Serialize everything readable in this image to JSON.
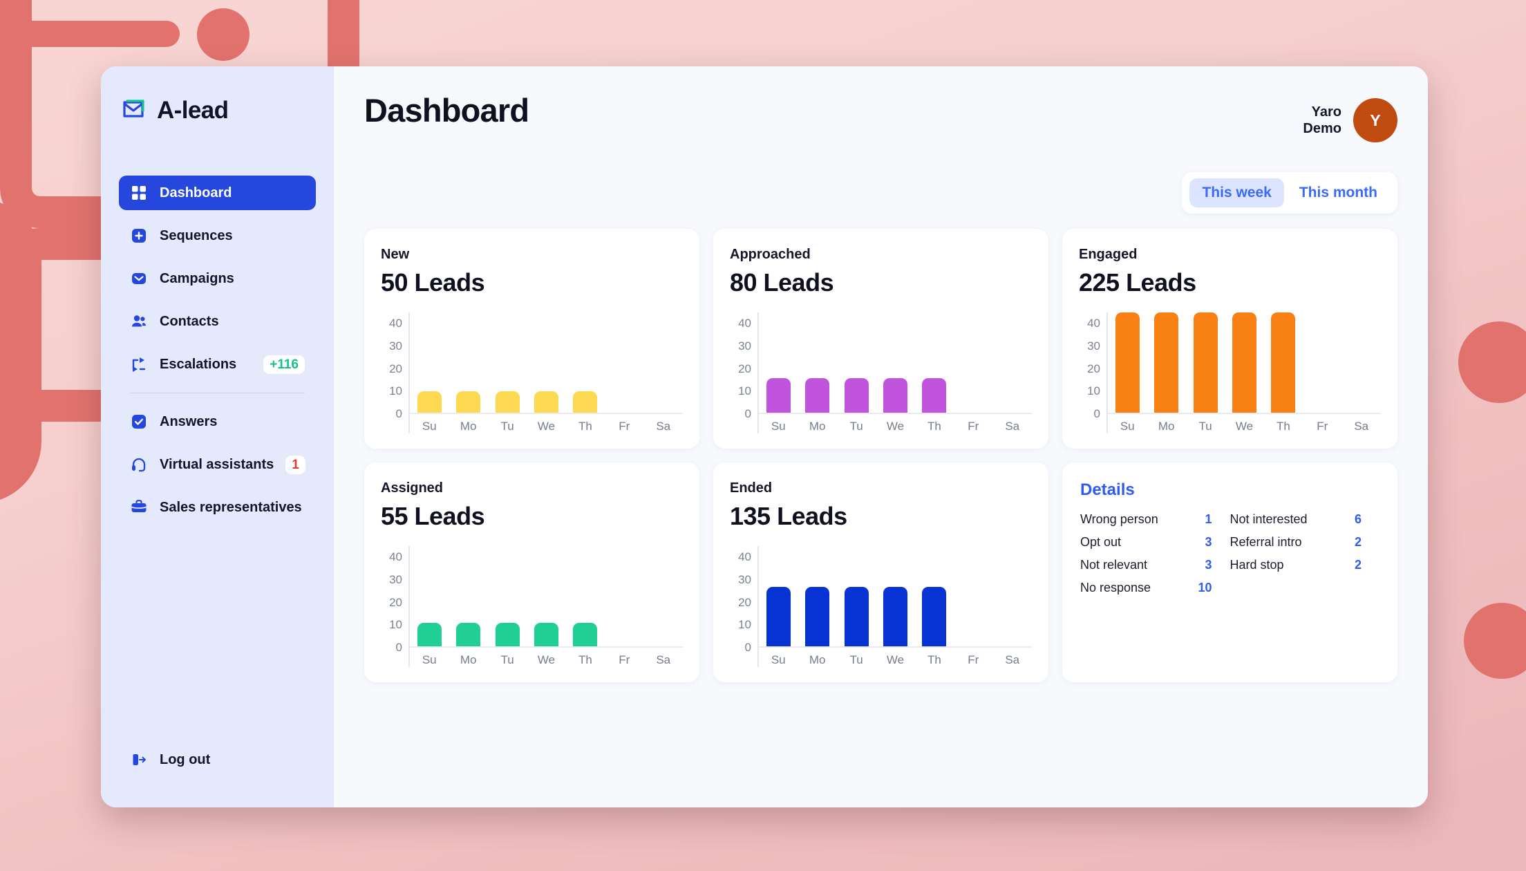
{
  "brand": {
    "name": "A-lead",
    "logo_icon": "envelope-logo-icon"
  },
  "sidebar": {
    "items": [
      {
        "label": "Dashboard",
        "icon": "grid-icon",
        "active": true,
        "badge": null
      },
      {
        "label": "Sequences",
        "icon": "plus-square-icon",
        "active": false,
        "badge": null
      },
      {
        "label": "Campaigns",
        "icon": "envelope-icon",
        "active": false,
        "badge": null
      },
      {
        "label": "Contacts",
        "icon": "people-icon",
        "active": false,
        "badge": null
      },
      {
        "label": "Escalations",
        "icon": "escalation-icon",
        "active": false,
        "badge": "+116",
        "badge_color": "green"
      },
      {
        "label": "Answers",
        "icon": "check-square-icon",
        "active": false,
        "badge": null
      },
      {
        "label": "Virtual assistants",
        "icon": "headset-icon",
        "active": false,
        "badge": "1",
        "badge_color": "red"
      },
      {
        "label": "Sales representatives",
        "icon": "briefcase-icon",
        "active": false,
        "badge": null
      }
    ],
    "logout": {
      "label": "Log out",
      "icon": "logout-icon"
    }
  },
  "header": {
    "title": "Dashboard",
    "user": {
      "line1": "Yaro",
      "line2": "Demo",
      "initial": "Y"
    }
  },
  "range_toggle": {
    "options": [
      {
        "label": "This week",
        "selected": true
      },
      {
        "label": "This month",
        "selected": false
      }
    ]
  },
  "colors": {
    "accent_blue": "#2647dd",
    "new": "#fcd950",
    "approached": "#c154dc",
    "engaged": "#f98012",
    "assigned": "#1fcf93",
    "ended": "#0833d4",
    "details_value": "#2f5cf0",
    "badge_green": "#16c088",
    "badge_red": "#e8392c",
    "avatar": "#bf4b11"
  },
  "cards": [
    {
      "label": "New",
      "value": "50 Leads",
      "chart_ref": 0
    },
    {
      "label": "Approached",
      "value": "80 Leads",
      "chart_ref": 1
    },
    {
      "label": "Engaged",
      "value": "225 Leads",
      "chart_ref": 2
    },
    {
      "label": "Assigned",
      "value": "55 Leads",
      "chart_ref": 3
    },
    {
      "label": "Ended",
      "value": "135 Leads",
      "chart_ref": 4
    }
  ],
  "details": {
    "title": "Details",
    "left": [
      {
        "label": "Wrong person",
        "value": "1"
      },
      {
        "label": "Opt out",
        "value": "3"
      },
      {
        "label": "Not relevant",
        "value": "3"
      },
      {
        "label": "No response",
        "value": "10"
      }
    ],
    "right": [
      {
        "label": "Not interested",
        "value": "6"
      },
      {
        "label": "Referral intro",
        "value": "2"
      },
      {
        "label": "Hard stop",
        "value": "2"
      }
    ]
  },
  "chart_data": [
    {
      "type": "bar",
      "title": "New",
      "subtitle": "50 Leads",
      "categories": [
        "Su",
        "Mo",
        "Tu",
        "We",
        "Th",
        "Fr",
        "Sa"
      ],
      "values": [
        10,
        10,
        10,
        10,
        10,
        0,
        0
      ],
      "yticks": [
        0,
        10,
        20,
        30,
        40
      ],
      "ylim": [
        0,
        45
      ],
      "color": "#fcd950",
      "xlabel": "",
      "ylabel": "",
      "grid": false,
      "legend": "none"
    },
    {
      "type": "bar",
      "title": "Approached",
      "subtitle": "80 Leads",
      "categories": [
        "Su",
        "Mo",
        "Tu",
        "We",
        "Th",
        "Fr",
        "Sa"
      ],
      "values": [
        16,
        16,
        16,
        16,
        16,
        0,
        0
      ],
      "yticks": [
        0,
        10,
        20,
        30,
        40
      ],
      "ylim": [
        0,
        45
      ],
      "color": "#c154dc",
      "xlabel": "",
      "ylabel": "",
      "grid": false,
      "legend": "none"
    },
    {
      "type": "bar",
      "title": "Engaged",
      "subtitle": "225 Leads",
      "categories": [
        "Su",
        "Mo",
        "Tu",
        "We",
        "Th",
        "Fr",
        "Sa"
      ],
      "values": [
        45,
        45,
        45,
        45,
        45,
        0,
        0
      ],
      "yticks": [
        0,
        10,
        20,
        30,
        40
      ],
      "ylim": [
        0,
        45
      ],
      "color": "#f98012",
      "xlabel": "",
      "ylabel": "",
      "grid": false,
      "legend": "none"
    },
    {
      "type": "bar",
      "title": "Assigned",
      "subtitle": "55 Leads",
      "categories": [
        "Su",
        "Mo",
        "Tu",
        "We",
        "Th",
        "Fr",
        "Sa"
      ],
      "values": [
        11,
        11,
        11,
        11,
        11,
        0,
        0
      ],
      "yticks": [
        0,
        10,
        20,
        30,
        40
      ],
      "ylim": [
        0,
        45
      ],
      "color": "#1fcf93",
      "xlabel": "",
      "ylabel": "",
      "grid": false,
      "legend": "none"
    },
    {
      "type": "bar",
      "title": "Ended",
      "subtitle": "135 Leads",
      "categories": [
        "Su",
        "Mo",
        "Tu",
        "We",
        "Th",
        "Fr",
        "Sa"
      ],
      "values": [
        27,
        27,
        27,
        27,
        27,
        0,
        0
      ],
      "yticks": [
        0,
        10,
        20,
        30,
        40
      ],
      "ylim": [
        0,
        45
      ],
      "color": "#0833d4",
      "xlabel": "",
      "ylabel": "",
      "grid": false,
      "legend": "none"
    }
  ]
}
